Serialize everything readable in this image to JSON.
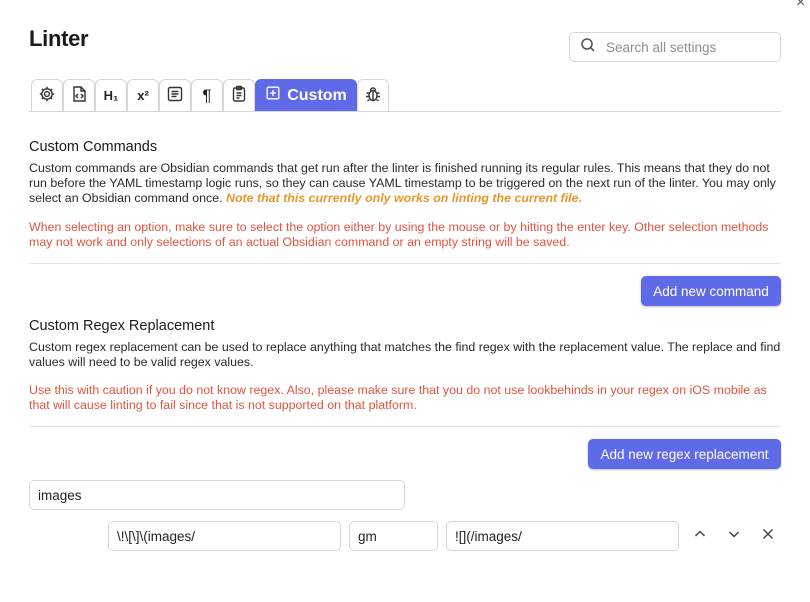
{
  "window": {
    "close_glyph": "×"
  },
  "page": {
    "title": "Linter"
  },
  "search": {
    "placeholder": "Search all settings",
    "value": ""
  },
  "tabs": [
    {
      "icon": "gear-icon",
      "label": ""
    },
    {
      "icon": "file-code-icon",
      "label": ""
    },
    {
      "icon": "heading-icon",
      "label": "H₁"
    },
    {
      "icon": "superscript-icon",
      "label": "x²"
    },
    {
      "icon": "paragraph-lines-icon",
      "label": ""
    },
    {
      "icon": "pilcrow-icon",
      "label": "¶"
    },
    {
      "icon": "clipboard-icon",
      "label": ""
    },
    {
      "icon": "plus-square-icon",
      "label": "Custom",
      "active": true
    },
    {
      "icon": "bug-icon",
      "label": ""
    }
  ],
  "custom_commands": {
    "heading": "Custom Commands",
    "description": "Custom commands are Obsidian commands that get run after the linter is finished running its regular rules. This means that they do not run before the YAML timestamp logic runs, so they can cause YAML timestamp to be triggered on the next run of the linter. You may only select an Obsidian command once.",
    "note": "Note that this currently only works on linting the current file.",
    "warning": "When selecting an option, make sure to select the option either by using the mouse or by hitting the enter key. Other selection methods may not work and only selections of an actual Obsidian command or an empty string will be saved.",
    "add_button": "Add new command"
  },
  "custom_regex": {
    "heading": "Custom Regex Replacement",
    "description": "Custom regex replacement can be used to replace anything that matches the find regex with the replacement value. The replace and find values will need to be valid regex values.",
    "warning": "Use this with caution if you do not know regex. Also, please make sure that you do not use lookbehinds in your regex on iOS mobile as that will cause linting to fail since that is not supported on that platform.",
    "add_button": "Add new regex replacement",
    "entries": [
      {
        "name": "images",
        "find": "\\!\\[\\]\\(images/",
        "flags": "gm",
        "replace": "![](/images/"
      }
    ]
  },
  "colors": {
    "accent": "#5f6ae8",
    "warning": "#e0533f",
    "note": "#e5972b"
  }
}
